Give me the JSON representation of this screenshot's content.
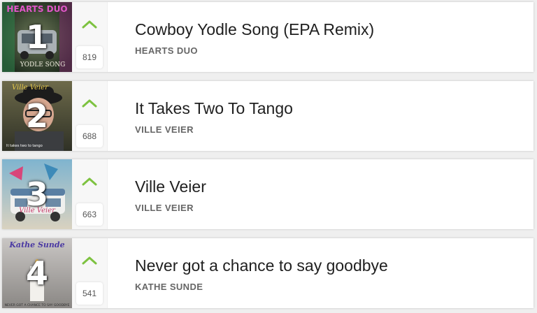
{
  "chart": {
    "entries": [
      {
        "rank": "1",
        "votes": "819",
        "title": "Cowboy Yodle Song (EPA Remix)",
        "artist": "HEARTS DUO",
        "cover_text": "HEARTS DUO",
        "cover_sub": "YODLE SONG",
        "cover_icon": "album-cover-car-image"
      },
      {
        "rank": "2",
        "votes": "688",
        "title": "It Takes Two To Tango",
        "artist": "VILLE VEIER",
        "cover_text": "Ville Veier",
        "cover_sub": "It takes two to tango",
        "cover_icon": "album-cover-portrait-image"
      },
      {
        "rank": "3",
        "votes": "663",
        "title": "Ville Veier",
        "artist": "VILLE VEIER",
        "cover_text": "Ville Veier",
        "cover_sub": "",
        "cover_icon": "album-cover-bus-image"
      },
      {
        "rank": "4",
        "votes": "541",
        "title": "Never got a chance to say goodbye",
        "artist": "KATHE SUNDE",
        "cover_text": "Kathe Sunde",
        "cover_sub": "NEVER GOT A CHANCE TO SAY GOODBYE",
        "cover_icon": "album-cover-candle-image"
      }
    ]
  },
  "colors": {
    "upvote": "#7dc240",
    "rank_text": "#ffffff",
    "title": "#1f1f1f",
    "artist": "#666666"
  },
  "icons": {
    "upvote": "chevron-up-icon"
  }
}
